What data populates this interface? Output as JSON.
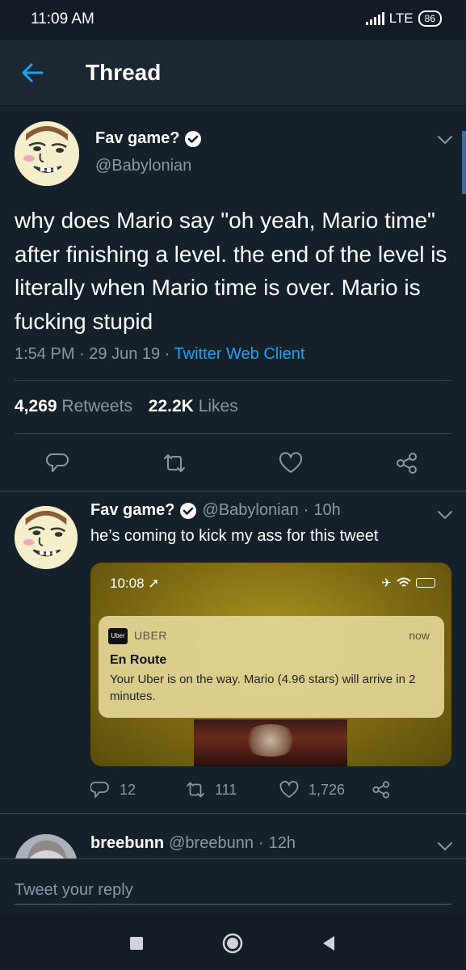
{
  "status_bar": {
    "time": "11:09 AM",
    "network": "LTE",
    "network_sub": "ıl",
    "battery": "86"
  },
  "header": {
    "title": "Thread"
  },
  "main_tweet": {
    "display_name": "Fav game?",
    "handle": "@Babylonian",
    "text": "why does Mario say \"oh yeah, Mario time\" after finishing a level. the end of the level is literally when Mario time is over. Mario is fucking stupid",
    "time": "1:54 PM",
    "date": "29 Jun 19",
    "source": "Twitter Web Client",
    "retweets_count": "4,269",
    "retweets_label": "Retweets",
    "likes_count": "22.2K",
    "likes_label": "Likes"
  },
  "reply_tweet": {
    "display_name": "Fav game?",
    "handle": "@Babylonian",
    "age": "10h",
    "text": "he’s coming to kick my ass for this tweet",
    "media": {
      "phone_time": "10:08",
      "notification": {
        "logo": "Uber",
        "app": "UBER",
        "time": "now",
        "title": "En Route",
        "body": "Your Uber is on the way. Mario (4.96 stars) will arrive in 2 minutes."
      }
    },
    "replies": "12",
    "retweets": "111",
    "likes": "1,726"
  },
  "third_tweet": {
    "display_name": "breebunn",
    "handle": "@breebunn",
    "age": "12h"
  },
  "reply_bar": {
    "placeholder": "Tweet your reply"
  },
  "icons": {
    "back": "arrow-left-icon",
    "verified": "verified-badge-icon",
    "chevron": "chevron-down-icon",
    "reply": "reply-icon",
    "retweet": "retweet-icon",
    "like": "heart-icon",
    "share": "share-icon"
  },
  "colors": {
    "background": "#15202b",
    "header": "#1c2733",
    "accent": "#1da1f2",
    "muted": "#8899a6",
    "divider": "#38444d"
  }
}
